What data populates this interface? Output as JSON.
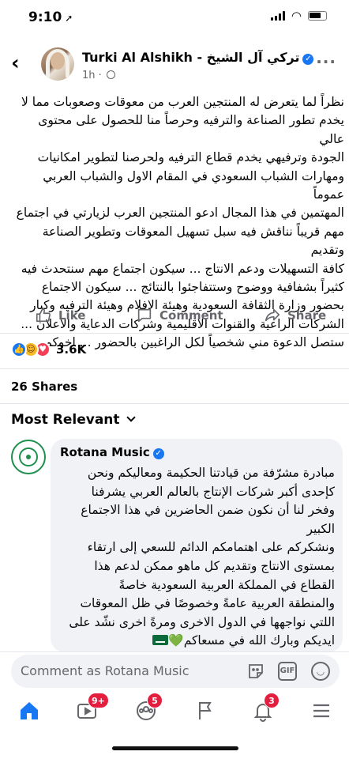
{
  "status_bar": {
    "time": "9:10"
  },
  "post": {
    "author": "Turki Al Alshikh - تركي آل الشيخ",
    "time": "1h",
    "text": "نظراً لما يتعرض له المنتجين العرب من معوقات وصعوبات مما لا\nيخدم تطور الصناعة والترفيه وحرصاً منا للحصول على محتوى عالي\nالجودة وترفيهي يخدم قطاع الترفيه ولحرصنا لتطوير امكانيات\nومهارات الشباب السعودي في المقام الاول والشباب العربي عموماً\nالمهتمين في هذا المجال ادعو المنتجين العرب لزيارتي في اجتماع\nمهم قريباً نناقش فيه سبل تسهيل المعوقات وتطوير الصناعة وتقديم\nكافة التسهيلات ودعم الانتاج ... سيكون اجتماع مهم سنتحدث فيه\nكثيراً بشفافية ووضوح وستتفاجئوا بالنتائج ... سيكون الاجتماع\nبحضور وزارة الثقافة السعودية وهيئة الافلام وهيئة الترفيه وكبار\nالشركات الراعية والقنوات الاقليمية وشركات الدعاية والاعلان ...\nستصل الدعوة مني شخصياً لكل الراغبين بالحضور ... اخوكم"
  },
  "actions": {
    "like": "Like",
    "comment": "Comment",
    "share": "Share"
  },
  "stats": {
    "reactions": "3.6K",
    "shares": "26 Shares"
  },
  "comments_filter": "Most Relevant",
  "comment": {
    "author": "Rotana Music",
    "text": "مبادرة مشرّفة من قيادتنا الحكيمة ومعاليكم ونحن\nكإحدى أكبر شركات الإنتاج بالعالم العربي يشرفنا\nوفخر لنا أن نكون ضمن الحاضرين في هذا الاجتماع\nالكبير\nونشكركم على اهتمامكم الدائم للسعي إلى ارتقاء\nبمستوى الانتاج وتقديم كل ماهو ممكن لدعم هذا\nالقطاع في المملكة العربية السعودية خاصةً\nوالمنطقة العربية عامةً وخصوصًا في ظل المعوقات\nاللتي نواجهها في الدول الاخرى ومرةً اخرى نشّد على\nايديكم وبارك الله في مسعاكم"
  },
  "composer": {
    "placeholder": "Comment as Rotana Music",
    "gif": "GIF"
  },
  "nav": {
    "watch_badge": "9+",
    "groups_badge": "5",
    "notifications_badge": "3"
  },
  "icons": [
    "back-icon",
    "avatar",
    "verified-icon",
    "globe-icon",
    "more-icon",
    "like-icon",
    "comment-icon",
    "share-icon",
    "sticker-icon",
    "gif-icon",
    "emoji-icon",
    "home-icon",
    "watch-icon",
    "groups-icon",
    "pages-icon",
    "notifications-icon",
    "menu-icon"
  ],
  "colors": {
    "accent": "#1877f2",
    "badge": "#e41e3f",
    "muted": "#65676b"
  }
}
